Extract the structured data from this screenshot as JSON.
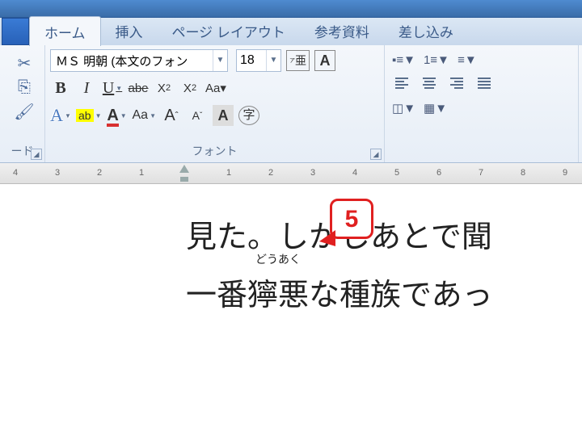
{
  "tabs": {
    "home": "ホーム",
    "insert": "挿入",
    "layout": "ページ レイアウト",
    "ref": "参考資料",
    "mail": "差し込み"
  },
  "clipboard": {
    "label": "ード"
  },
  "font": {
    "name": "ＭＳ 明朝 (本文のフォン",
    "size": "18",
    "label": "フォント"
  },
  "document": {
    "line1": "見た。しかしあとで聞",
    "ruby_text": "どうあく",
    "line2a": "一番",
    "line2b": "獰悪",
    "line2c": "な種族であっ"
  },
  "callout": "5",
  "ruler": {
    "left": [
      "4",
      "3",
      "2",
      "1"
    ],
    "right": [
      "1",
      "2",
      "3",
      "4",
      "5",
      "6",
      "7",
      "8",
      "9"
    ]
  },
  "leftpanel": "ド"
}
